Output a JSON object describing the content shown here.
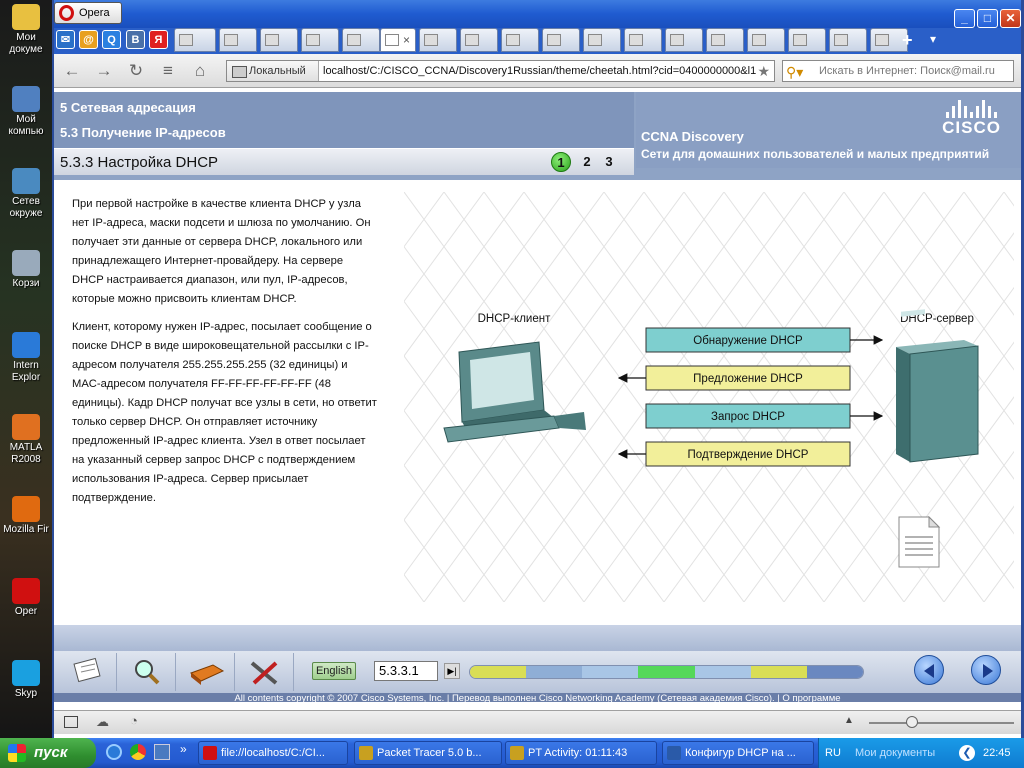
{
  "desktop": {
    "icons": [
      {
        "label": "Мои докуме",
        "color": "#e8c040"
      },
      {
        "label": "Мой компью",
        "color": "#5080c0"
      },
      {
        "label": "Сетев окруже",
        "color": "#4a8ac0"
      },
      {
        "label": "Корзи",
        "color": "#9ab"
      },
      {
        "label": "Intern Explor",
        "color": "#2a7ad8"
      },
      {
        "label": "MATLA R2008",
        "color": "#e07020"
      },
      {
        "label": "Mozilla Fir",
        "color": "#e06a10"
      },
      {
        "label": "Oper",
        "color": "#d01010"
      },
      {
        "label": "Skyp",
        "color": "#1aa0e0"
      }
    ]
  },
  "window": {
    "app_name": "Opera",
    "minimize": "_",
    "maximize": "□",
    "close": "✕"
  },
  "tabs": {
    "new_tab": "+",
    "menu": "▾",
    "speed_letters": [
      "В",
      "Я"
    ]
  },
  "nav": {
    "location_label": "Локальный",
    "url": "localhost/C:/CISCO_CCNA/Discovery1Russian/theme/cheetah.html?cid=0400000000&l1",
    "search_placeholder": "Искать в Интернет: Поиск@mail.ru"
  },
  "header": {
    "breadcrumb1": "5 Сетевая адресация",
    "breadcrumb2": "5.3 Получение IP-адресов",
    "page_title": "5.3.3 Настройка DHCP",
    "pages": [
      "1",
      "2",
      "3"
    ],
    "course": "CCNA Discovery",
    "course_sub": "Сети для домашних пользователей и малых предприятий",
    "logo": "CISCO"
  },
  "body": {
    "p1": "При первой настройке в качестве клиента DHCP у узла нет IP-адреса, маски подсети и шлюза по умолчанию. Он получает эти данные от сервера DHCP, локального или принадлежащего Интернет-провайдеру. На сервере DHCP настраивается диапазон, или пул, IP-адресов, которые можно присвоить клиентам DHCP.",
    "p2": "Клиент, которому нужен IP-адрес, посылает сообщение о поиске DHCP в виде широковещательной рассылки с IP-адресом получателя 255.255.255.255 (32 единицы) и MAC-адресом получателя FF-FF-FF-FF-FF-FF (48 единицы). Кадр DHCP получат все узлы в сети, но ответит только сервер DHCP. Он отправляет источнику предложенный IP-адрес клиента. Узел в ответ посылает на указанный сервер запрос DHCP с подтверждением использования IP-адреса. Сервер присылает подтверждение."
  },
  "diagram": {
    "client_label": "DHCP-клиент",
    "server_label": "DHCP-сервер",
    "messages": [
      {
        "label": "Обнаружение DHCP",
        "direction": "to-server",
        "color": "#7ecfcf"
      },
      {
        "label": "Предложение DHCP",
        "direction": "to-client",
        "color": "#f2ef9a"
      },
      {
        "label": "Запрос DHCP",
        "direction": "to-server",
        "color": "#7ecfcf"
      },
      {
        "label": "Подтверждение DHCP",
        "direction": "to-client",
        "color": "#f2ef9a"
      }
    ]
  },
  "footer": {
    "language": "English",
    "page_code": "5.3.3.1",
    "go": "▶|",
    "copyright": "All contents copyright © 2007 Cisco Systems, Inc. | Перевод выполнен Cisco Networking Academy (Сетевая академия Cisco). |",
    "about": "О программе"
  },
  "taskbar": {
    "start": "пуск",
    "buttons": [
      {
        "label": "file://localhost/C:/CI...",
        "color": "#d01010"
      },
      {
        "label": "Packet Tracer 5.0 b...",
        "color": "#c8a020"
      },
      {
        "label": "PT Activity: 01:11:43",
        "color": "#c8a020"
      },
      {
        "label": "Конфигур DHCP на ...",
        "color": "#2a5aa8"
      }
    ],
    "lang": "RU",
    "docs": "Мои документы",
    "time": "22:45"
  }
}
